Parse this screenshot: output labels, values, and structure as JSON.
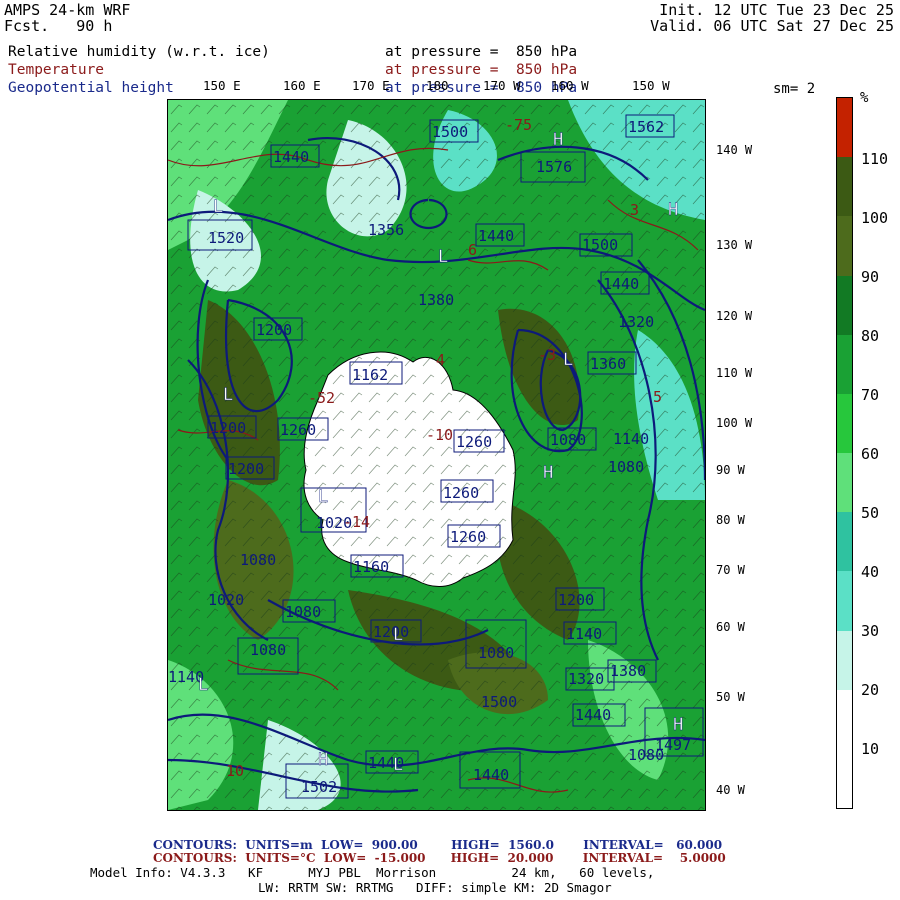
{
  "header": {
    "model": "AMPS 24-km WRF",
    "forecast": "Fcst.   90 h",
    "init": "Init. 12 UTC Tue 23 Dec 25",
    "valid": "Valid. 06 UTC Sat 27 Dec 25"
  },
  "fields": [
    {
      "name": "Relative humidity (w.r.t. ice)",
      "level": "at pressure =  850 hPa",
      "color": "#000000"
    },
    {
      "name": "Temperature",
      "level": "at pressure =  850 hPa",
      "color": "#8b1a1a"
    },
    {
      "name": "Geopotential height",
      "level": "at pressure =  850 hPa",
      "color": "#1a2a8b"
    }
  ],
  "smoothing": "sm= 2",
  "top_ticks": [
    "150 E",
    "160 E",
    "170 E",
    "180",
    "170 W",
    "160 W",
    "150 W"
  ],
  "right_ticks": [
    "140 W",
    "130 W",
    "120 W",
    "110 W",
    "100 W",
    "90 W",
    "80 W",
    "70 W",
    "60 W",
    "50 W",
    "40 W"
  ],
  "colorbar": {
    "unit": "%",
    "labels": [
      "110",
      "100",
      "90",
      "80",
      "70",
      "60",
      "50",
      "40",
      "30",
      "20",
      "10"
    ],
    "colors": [
      "#c42200",
      "#3c5a14",
      "#4d6b1c",
      "#127a24",
      "#1aa134",
      "#27c73c",
      "#5fe07a",
      "#2fc2a0",
      "#5be0c6",
      "#c6f4e8",
      "#ffffff",
      "#ffffff"
    ]
  },
  "map_labels": {
    "heights": [
      "1440",
      "1500",
      "1562",
      "1576",
      "1520",
      "1356",
      "1440",
      "1500",
      "1440",
      "1200",
      "1380",
      "1320",
      "1162",
      "1260",
      "1080",
      "1140",
      "1360",
      "1200",
      "1260",
      "1080",
      "1200",
      "1260",
      "1020",
      "1260",
      "1160",
      "1080",
      "1020",
      "1200",
      "1080",
      "1200",
      "1140",
      "1320",
      "1080",
      "1080",
      "1380",
      "1500",
      "1440",
      "1440",
      "1497",
      "1440",
      "1140",
      "1080",
      "1502"
    ],
    "temps": [
      "-52",
      "-10",
      "-14",
      "4",
      "6",
      "-75",
      "10",
      "3",
      "5",
      "-3"
    ],
    "lows": [
      "L",
      "L",
      "L",
      "L",
      "L",
      "L",
      "L",
      "L"
    ],
    "highs": [
      "H",
      "H",
      "H",
      "H",
      "H"
    ]
  },
  "footer": {
    "contours1": "CONTOURS:  UNITS=m  LOW=  900.00        HIGH=  1560.0       INTERVAL=   60.000",
    "contours2": "CONTOURS:  UNITS=°C  LOW=  -15.000      HIGH=  20.000       INTERVAL=    5.0000",
    "info1": "Model Info: V4.3.3   KF      MYJ PBL  Morrison          24 km,   60 levels,",
    "info2": "LW: RRTM SW: RRTMG   DIFF: simple KM: 2D Smagor",
    "contours1_color": "#1a2a8b",
    "contours2_color": "#8b1a1a"
  }
}
